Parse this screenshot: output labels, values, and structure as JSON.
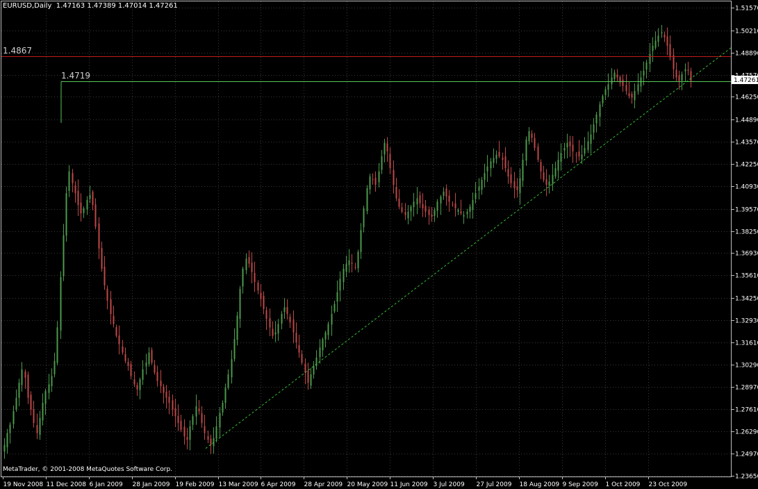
{
  "header": {
    "symbol": "EURUSD,Daily",
    "ohlc": "1.47163 1.47389 1.47014 1.47261"
  },
  "copyright": "MetaTrader, © 2001-2008 MetaQuotes Software Corp.",
  "current_price_label": "1.47261",
  "colors": {
    "background": "#000000",
    "frame": "#c0c0c0",
    "grid": "#3a3a3a",
    "bull": "#4c9a4c",
    "bear": "#c04848",
    "resistance_line": "#c01c1c",
    "support_line": "#56c856",
    "trendline": "#36c236"
  },
  "chart_data": {
    "type": "candlestick",
    "grid": true,
    "x_labels": [
      "19 Nov 2008",
      "11 Dec 2008",
      "6 Jan 2009",
      "28 Jan 2009",
      "19 Feb 2009",
      "13 Mar 2009",
      "6 Apr 2009",
      "28 Apr 2009",
      "20 May 2009",
      "11 Jun 2009",
      "3 Jul 2009",
      "27 Jul 2009",
      "18 Aug 2009",
      "9 Sep 2009",
      "1 Oct 2009",
      "23 Oct 2009"
    ],
    "y_ticks": [
      "1.51570",
      "1.50210",
      "1.48890",
      "1.47570",
      "1.46250",
      "1.44890",
      "1.43570",
      "1.42250",
      "1.40930",
      "1.39570",
      "1.38250",
      "1.36930",
      "1.35610",
      "1.34250",
      "1.32930",
      "1.31610",
      "1.30290",
      "1.28970",
      "1.27610",
      "1.26290",
      "1.24970",
      "1.23650"
    ],
    "ylim": [
      1.2365,
      1.5157
    ],
    "horizontal_levels": [
      {
        "label": "1.4867",
        "value": 1.4867,
        "color": "red"
      },
      {
        "label": "1.4719",
        "value": 1.4719,
        "color": "green"
      }
    ],
    "trendline": {
      "start": {
        "date": "3 Mar 2009",
        "price": 1.2528
      },
      "end": {
        "date": "10 Nov 2009",
        "price": 1.492
      },
      "style": "dotted"
    },
    "last_close": 1.47261,
    "approx_daily_closes": [
      1.255,
      1.262,
      1.267,
      1.275,
      1.283,
      1.292,
      1.3,
      1.295,
      1.283,
      1.276,
      1.268,
      1.262,
      1.271,
      1.28,
      1.287,
      1.291,
      1.296,
      1.305,
      1.325,
      1.355,
      1.38,
      1.405,
      1.418,
      1.411,
      1.405,
      1.398,
      1.393,
      1.396,
      1.401,
      1.404,
      1.398,
      1.385,
      1.372,
      1.36,
      1.35,
      1.341,
      1.333,
      1.327,
      1.32,
      1.315,
      1.31,
      1.305,
      1.302,
      1.296,
      1.291,
      1.288,
      1.294,
      1.3,
      1.304,
      1.31,
      1.304,
      1.298,
      1.293,
      1.29,
      1.286,
      1.283,
      1.28,
      1.276,
      1.272,
      1.268,
      1.264,
      1.26,
      1.258,
      1.266,
      1.272,
      1.278,
      1.275,
      1.268,
      1.262,
      1.258,
      1.255,
      1.259,
      1.266,
      1.274,
      1.28,
      1.289,
      1.297,
      1.306,
      1.318,
      1.332,
      1.348,
      1.36,
      1.366,
      1.363,
      1.358,
      1.352,
      1.347,
      1.342,
      1.336,
      1.33,
      1.325,
      1.32,
      1.322,
      1.327,
      1.333,
      1.337,
      1.333,
      1.328,
      1.322,
      1.316,
      1.31,
      1.304,
      1.298,
      1.292,
      1.297,
      1.302,
      1.307,
      1.313,
      1.318,
      1.322,
      1.327,
      1.333,
      1.339,
      1.346,
      1.354,
      1.36,
      1.363,
      1.365,
      1.363,
      1.361,
      1.37,
      1.383,
      1.396,
      1.408,
      1.415,
      1.413,
      1.41,
      1.418,
      1.427,
      1.435,
      1.43,
      1.42,
      1.41,
      1.402,
      1.397,
      1.394,
      1.392,
      1.394,
      1.397,
      1.4,
      1.402,
      1.399,
      1.396,
      1.394,
      1.392,
      1.391,
      1.395,
      1.4,
      1.403,
      1.406,
      1.403,
      1.4,
      1.398,
      1.396,
      1.395,
      1.393,
      1.392,
      1.394,
      1.397,
      1.401,
      1.405,
      1.409,
      1.413,
      1.417,
      1.421,
      1.424,
      1.426,
      1.428,
      1.427,
      1.425,
      1.42,
      1.415,
      1.411,
      1.408,
      1.407,
      1.414,
      1.425,
      1.437,
      1.442,
      1.438,
      1.432,
      1.425,
      1.418,
      1.413,
      1.41,
      1.412,
      1.416,
      1.42,
      1.425,
      1.429,
      1.432,
      1.435,
      1.433,
      1.43,
      1.428,
      1.427,
      1.428,
      1.432,
      1.436,
      1.44,
      1.446,
      1.452,
      1.458,
      1.463,
      1.467,
      1.47,
      1.474,
      1.477,
      1.474,
      1.471,
      1.469,
      1.466,
      1.463,
      1.462,
      1.466,
      1.47,
      1.474,
      1.478,
      1.483,
      1.488,
      1.493,
      1.496,
      1.499,
      1.501,
      1.498,
      1.493,
      1.486,
      1.479,
      1.474,
      1.472,
      1.476,
      1.479,
      1.478,
      1.472
    ]
  }
}
